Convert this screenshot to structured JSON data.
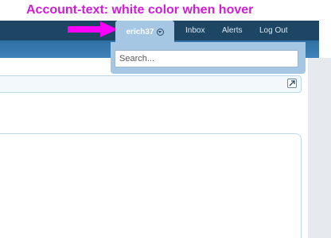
{
  "annotation": {
    "text": "Account-text: white color when hover",
    "color": "#d11cd6"
  },
  "header": {
    "account": {
      "username": "erich37",
      "dropdown_icon": "chevron-down-circle-icon"
    },
    "nav": {
      "inbox": "Inbox",
      "alerts": "Alerts",
      "logout": "Log Out"
    }
  },
  "search": {
    "placeholder": "Search..."
  },
  "icons": {
    "expand": "external-link-icon",
    "arrow": "arrow-right-icon"
  },
  "colors": {
    "topbar": "#1d4665",
    "account_tab": "#a5c7e4",
    "arrow": "#ff00ff"
  }
}
